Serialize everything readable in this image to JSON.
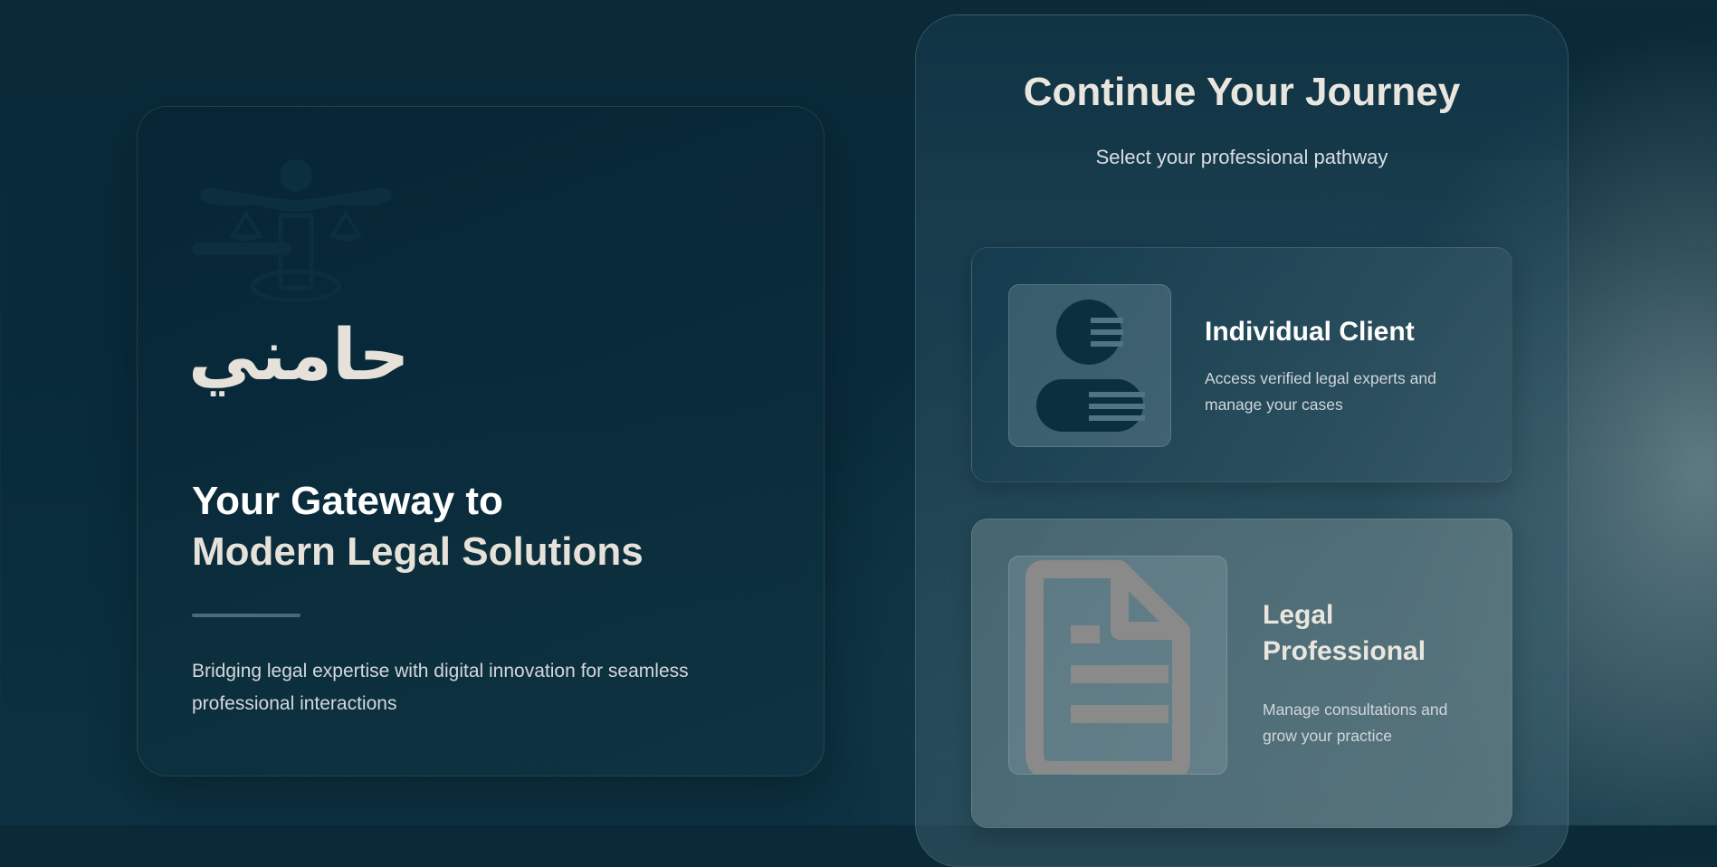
{
  "brand": {
    "logo_icon": "scales-of-justice-icon",
    "wordmark": "حامني"
  },
  "hero": {
    "headline_line1": "Your Gateway to",
    "headline_line2": "Modern Legal Solutions",
    "tagline": "Bridging legal expertise with digital innovation for seamless professional interactions"
  },
  "panel": {
    "title": "Continue Your Journey",
    "subtitle": "Select your professional pathway",
    "options": [
      {
        "icon": "user-icon",
        "title": "Individual Client",
        "description": "Access verified legal experts and manage your cases"
      },
      {
        "icon": "document-icon",
        "title": "Legal Professional",
        "description": "Manage consultations and grow your practice"
      }
    ]
  },
  "colors": {
    "background": "#082a3a",
    "accent_text": "#e6e2da",
    "icon_dark": "#0b2f3f",
    "document_icon": "#8a8a8a"
  }
}
